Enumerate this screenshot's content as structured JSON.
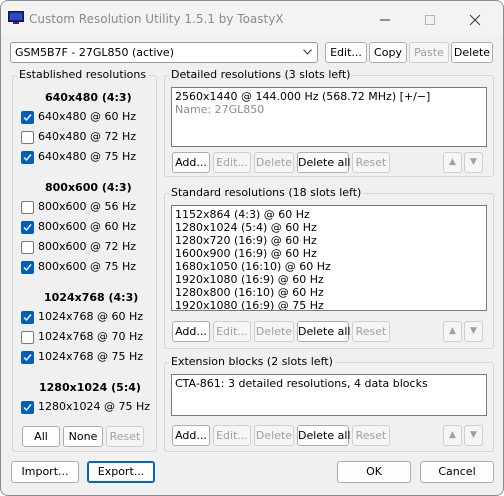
{
  "window": {
    "title": "Custom Resolution Utility 1.5.1 by ToastyX"
  },
  "monitor": {
    "selected": "GSM5B7F - 27GL850 (active)"
  },
  "top_buttons": {
    "edit": "Edit...",
    "copy": "Copy",
    "paste": "Paste",
    "delete": "Delete"
  },
  "established": {
    "title": "Established resolutions",
    "groups": [
      {
        "heading": "640x480 (4:3)",
        "items": [
          {
            "label": "640x480 @ 60 Hz",
            "checked": true
          },
          {
            "label": "640x480 @ 72 Hz",
            "checked": false
          },
          {
            "label": "640x480 @ 75 Hz",
            "checked": true
          }
        ]
      },
      {
        "heading": "800x600 (4:3)",
        "items": [
          {
            "label": "800x600 @ 56 Hz",
            "checked": false
          },
          {
            "label": "800x600 @ 60 Hz",
            "checked": true
          },
          {
            "label": "800x600 @ 72 Hz",
            "checked": false
          },
          {
            "label": "800x600 @ 75 Hz",
            "checked": true
          }
        ]
      },
      {
        "heading": "1024x768 (4:3)",
        "items": [
          {
            "label": "1024x768 @ 60 Hz",
            "checked": true
          },
          {
            "label": "1024x768 @ 70 Hz",
            "checked": false
          },
          {
            "label": "1024x768 @ 75 Hz",
            "checked": true
          }
        ]
      },
      {
        "heading": "1280x1024 (5:4)",
        "items": [
          {
            "label": "1280x1024 @ 75 Hz",
            "checked": true
          }
        ]
      }
    ],
    "buttons": {
      "all": "All",
      "none": "None",
      "reset": "Reset"
    }
  },
  "detailed": {
    "title": "Detailed resolutions (3 slots left)",
    "lines": [
      "2560x1440 @ 144.000 Hz (568.72 MHz) [+/−]"
    ],
    "name_line": "Name: 27GL850"
  },
  "standard": {
    "title": "Standard resolutions (18 slots left)",
    "lines": [
      "1152x864 (4:3) @ 60 Hz",
      "1280x1024 (5:4) @ 60 Hz",
      "1280x720 (16:9) @ 60 Hz",
      "1600x900 (16:9) @ 60 Hz",
      "1680x1050 (16:10) @ 60 Hz",
      "1920x1080 (16:9) @ 60 Hz",
      "1280x800 (16:10) @ 60 Hz",
      "1920x1080 (16:9) @ 75 Hz"
    ]
  },
  "extension": {
    "title": "Extension blocks (2 slots left)",
    "lines": [
      "CTA-861: 3 detailed resolutions, 4 data blocks"
    ]
  },
  "section_buttons": {
    "add": "Add...",
    "edit": "Edit...",
    "delete": "Delete",
    "delete_all": "Delete all",
    "reset": "Reset"
  },
  "bottom": {
    "import": "Import...",
    "export": "Export...",
    "ok": "OK",
    "cancel": "Cancel"
  },
  "colors": {
    "accent": "#005fb8",
    "window_bg": "#f0f0f0",
    "disabled_text": "#a0a0a0"
  }
}
